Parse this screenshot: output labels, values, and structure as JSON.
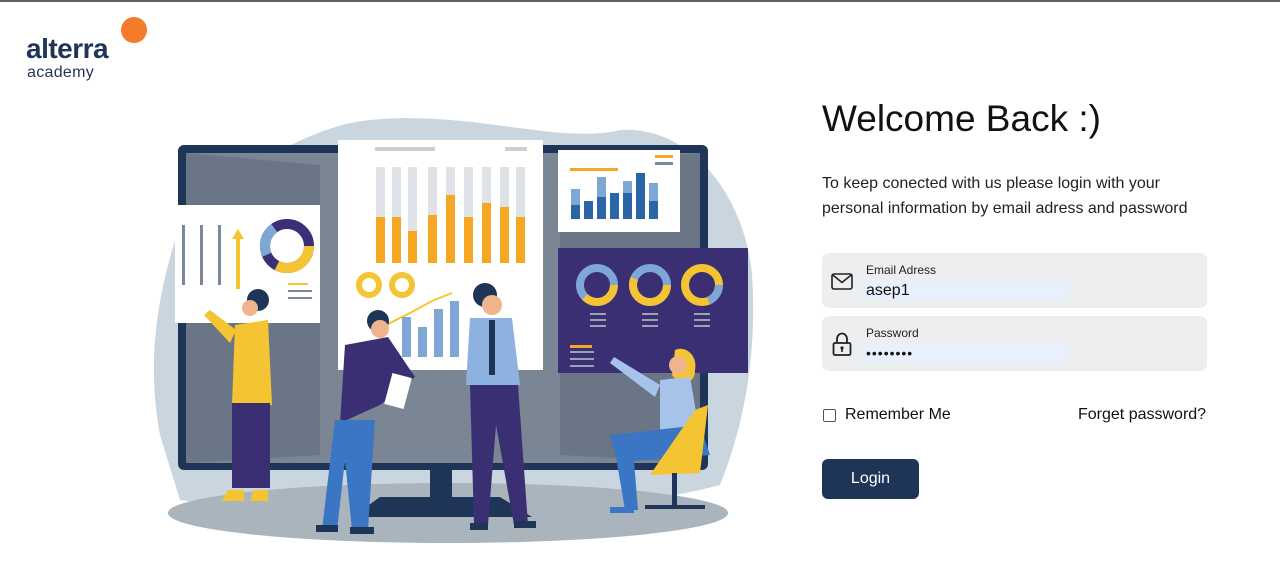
{
  "brand": {
    "name": "alterra",
    "subname": "academy",
    "colors": {
      "primary": "#1e3557",
      "accent": "#f47b2a"
    }
  },
  "illustration": {
    "description_icon": "business-analytics-illustration"
  },
  "login": {
    "title": "Welcome Back :)",
    "subtitle": "To keep conected with us please login with your personal information by email adress and password",
    "email": {
      "label": "Email Adress",
      "value": "asep1",
      "icon": "mail-icon"
    },
    "password": {
      "label": "Password",
      "value": "••••••••",
      "icon": "lock-icon"
    },
    "remember_label": "Remember Me",
    "remember_checked": false,
    "forgot_label": "Forget password?",
    "submit_label": "Login"
  }
}
